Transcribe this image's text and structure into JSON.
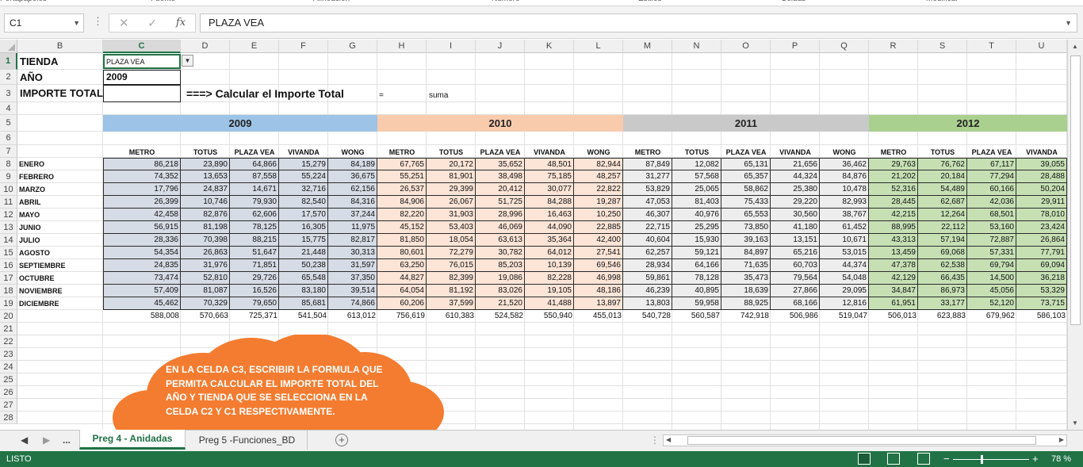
{
  "ribbon": {
    "groups": [
      "Portapapeles",
      "Fuente",
      "Alineación",
      "Número",
      "Estilos",
      "Celdas",
      "Modificar"
    ]
  },
  "formula_bar": {
    "name_box": "C1",
    "cancel_icon": "✕",
    "enter_icon": "✓",
    "fx_label": "fx",
    "content": "PLAZA VEA"
  },
  "columns": [
    "B",
    "C",
    "D",
    "E",
    "F",
    "G",
    "H",
    "I",
    "J",
    "K",
    "L",
    "M",
    "N",
    "O",
    "P",
    "Q",
    "R",
    "S",
    "T",
    "U"
  ],
  "rows": [
    "1",
    "2",
    "3",
    "4",
    "5",
    "6",
    "7",
    "8",
    "9",
    "10",
    "11",
    "12",
    "13",
    "14",
    "15",
    "16",
    "17",
    "18",
    "19",
    "20",
    "21",
    "22",
    "23",
    "24",
    "25",
    "26",
    "27",
    "28"
  ],
  "sheet": {
    "label_tienda": "TIENDA",
    "label_anio": "AÑO",
    "label_importe": "IMPORTE TOTAL",
    "c1_value": "PLAZA VEA",
    "c2_value": "2009",
    "calc_note": "===> Calcular el Importe Total",
    "equals": "=",
    "suma": "suma",
    "years": [
      "2009",
      "2010",
      "2011",
      "2012"
    ],
    "year_colors": [
      "#9dc3e6",
      "#f8cbad",
      "#c9c9c9",
      "#a9d08e"
    ],
    "data_colors": [
      "#d6dce5",
      "#fce4d6",
      "#ededed",
      "#c6e0b4"
    ],
    "stores": [
      "METRO",
      "TOTUS",
      "PLAZA VEA",
      "VIVANDA",
      "WONG",
      "METRO",
      "TOTUS",
      "PLAZA VEA",
      "VIVANDA",
      "WONG",
      "METRO",
      "TOTUS",
      "PLAZA VEA",
      "VIVANDA",
      "WONG",
      "METRO",
      "TOTUS",
      "PLAZA VEA",
      "VIVANDA"
    ],
    "months": [
      "ENERO",
      "FEBRERO",
      "MARZO",
      "ABRIL",
      "MAYO",
      "JUNIO",
      "JULIO",
      "AGOSTO",
      "SEPTIEMBRE",
      "OCTUBRE",
      "NOVIEMBRE",
      "DICIEMBRE"
    ],
    "data": [
      [
        "86,218",
        "23,890",
        "64,866",
        "15,279",
        "84,189",
        "67,765",
        "20,172",
        "35,652",
        "48,501",
        "82,944",
        "87,849",
        "12,082",
        "65,131",
        "21,656",
        "36,462",
        "29,763",
        "76,762",
        "67,117",
        "39,055"
      ],
      [
        "74,352",
        "13,653",
        "87,558",
        "55,224",
        "36,675",
        "55,251",
        "81,901",
        "38,498",
        "75,185",
        "48,257",
        "31,277",
        "57,568",
        "65,357",
        "44,324",
        "84,876",
        "21,202",
        "20,184",
        "77,294",
        "28,488"
      ],
      [
        "17,796",
        "24,837",
        "14,671",
        "32,716",
        "62,156",
        "26,537",
        "29,399",
        "20,412",
        "30,077",
        "22,822",
        "53,829",
        "25,065",
        "58,862",
        "25,380",
        "10,478",
        "52,316",
        "54,489",
        "60,166",
        "50,204"
      ],
      [
        "26,399",
        "10,746",
        "79,930",
        "82,540",
        "84,316",
        "84,906",
        "26,067",
        "51,725",
        "84,288",
        "19,287",
        "47,053",
        "81,403",
        "75,433",
        "29,220",
        "82,993",
        "28,445",
        "62,687",
        "42,036",
        "29,911"
      ],
      [
        "42,458",
        "82,876",
        "62,606",
        "17,570",
        "37,244",
        "82,220",
        "31,903",
        "28,996",
        "16,463",
        "10,250",
        "46,307",
        "40,976",
        "65,553",
        "30,560",
        "38,767",
        "42,215",
        "12,264",
        "68,501",
        "78,010"
      ],
      [
        "56,915",
        "81,198",
        "78,125",
        "16,305",
        "11,975",
        "45,152",
        "53,403",
        "46,069",
        "44,090",
        "22,885",
        "22,715",
        "25,295",
        "73,850",
        "41,180",
        "61,452",
        "88,995",
        "22,112",
        "53,160",
        "23,424"
      ],
      [
        "28,336",
        "70,398",
        "88,215",
        "15,775",
        "82,817",
        "81,850",
        "18,054",
        "63,613",
        "35,364",
        "42,400",
        "40,604",
        "15,930",
        "39,163",
        "13,151",
        "10,671",
        "43,313",
        "57,194",
        "72,887",
        "26,864"
      ],
      [
        "54,354",
        "26,863",
        "51,647",
        "21,448",
        "30,313",
        "80,601",
        "72,279",
        "30,782",
        "64,012",
        "27,541",
        "62,257",
        "59,121",
        "84,897",
        "65,216",
        "53,015",
        "13,459",
        "69,068",
        "57,331",
        "77,791"
      ],
      [
        "24,835",
        "31,976",
        "71,851",
        "50,238",
        "31,597",
        "63,250",
        "76,015",
        "85,203",
        "10,139",
        "69,546",
        "28,934",
        "64,166",
        "71,635",
        "60,703",
        "44,374",
        "47,378",
        "62,538",
        "69,794",
        "69,094"
      ],
      [
        "73,474",
        "52,810",
        "29,726",
        "65,548",
        "37,350",
        "44,827",
        "82,399",
        "19,086",
        "82,228",
        "46,998",
        "59,861",
        "78,128",
        "35,473",
        "79,564",
        "54,048",
        "42,129",
        "66,435",
        "14,500",
        "36,218"
      ],
      [
        "57,409",
        "81,087",
        "16,526",
        "83,180",
        "39,514",
        "64,054",
        "81,192",
        "83,026",
        "19,105",
        "48,186",
        "46,239",
        "40,895",
        "18,639",
        "27,866",
        "29,095",
        "34,847",
        "86,973",
        "45,056",
        "53,329"
      ],
      [
        "45,462",
        "70,329",
        "79,650",
        "85,681",
        "74,866",
        "60,206",
        "37,599",
        "21,520",
        "41,488",
        "13,897",
        "13,803",
        "59,958",
        "88,925",
        "68,166",
        "12,816",
        "61,951",
        "33,177",
        "52,120",
        "73,715"
      ]
    ],
    "totals": [
      "588,008",
      "570,663",
      "725,371",
      "541,504",
      "613,012",
      "756,619",
      "610,383",
      "524,582",
      "550,940",
      "455,013",
      "540,728",
      "560,587",
      "742,918",
      "506,986",
      "519,047",
      "506,013",
      "623,883",
      "679,962",
      "586,103"
    ],
    "cloud_text": "EN LA CELDA C3, ESCRIBIR LA FORMULA QUE PERMITA CALCULAR EL IMPORTE TOTAL DEL AÑO Y TIENDA QUE SE SELECCIONA EN LA CELDA C2 Y C1 RESPECTIVAMENTE.",
    "cloud_color": "#f47c30"
  },
  "tabs": {
    "ellipsis": "...",
    "active": "Preg 4 - Anidadas",
    "other": "Preg 5 -Funciones_BD",
    "add": "+"
  },
  "status": {
    "text": "LISTO",
    "zoom_minus": "−",
    "zoom_plus": "+",
    "zoom": "78 %"
  }
}
